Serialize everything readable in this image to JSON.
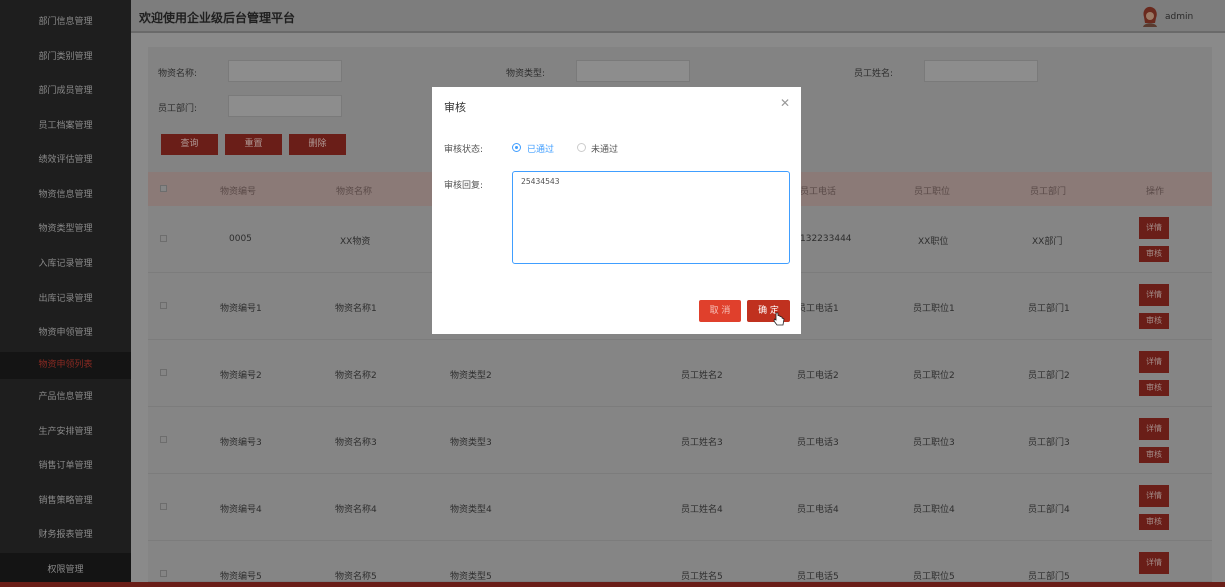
{
  "header": {
    "title": "欢迎使用企业级后台管理平台",
    "user": "admin",
    "avatar_icon": "user-avatar-icon"
  },
  "sidebar": {
    "items": [
      {
        "label": "部门信息管理"
      },
      {
        "label": "部门类别管理"
      },
      {
        "label": "部门成员管理"
      },
      {
        "label": "员工档案管理"
      },
      {
        "label": "绩效评估管理"
      },
      {
        "label": "物资信息管理"
      },
      {
        "label": "物资类型管理"
      },
      {
        "label": "入库记录管理"
      },
      {
        "label": "出库记录管理"
      },
      {
        "label": "物资申领管理"
      },
      {
        "label": "物资申领列表"
      },
      {
        "label": "产品信息管理"
      },
      {
        "label": "生产安排管理"
      },
      {
        "label": "销售订单管理"
      },
      {
        "label": "销售策略管理"
      },
      {
        "label": "财务报表管理"
      },
      {
        "label": "权限管理"
      }
    ]
  },
  "filters": {
    "material_name": {
      "label": "物资名称:",
      "value": ""
    },
    "material_type": {
      "label": "物资类型:",
      "value": ""
    },
    "employee_name": {
      "label": "员工姓名:",
      "value": ""
    },
    "employee_dept": {
      "label": "员工部门:",
      "value": ""
    },
    "query_label": "查询",
    "reset_label": "重置",
    "delete_label": "删除"
  },
  "table": {
    "columns": [
      "物资编号",
      "物资名称",
      "员工电话",
      "员工职位",
      "员工部门",
      "操作"
    ],
    "rows": [
      {
        "id": "0005",
        "name": "XX物资",
        "type": "",
        "emp": "",
        "phone": "132233444",
        "pos": "XX职位",
        "dept": "XX部门"
      },
      {
        "id": "物资编号1",
        "name": "物资名称1",
        "type": "",
        "emp": "",
        "phone": "员工电话1",
        "pos": "员工职位1",
        "dept": "员工部门1"
      },
      {
        "id": "物资编号2",
        "name": "物资名称2",
        "type": "物资类型2",
        "emp": "员工姓名2",
        "phone": "员工电话2",
        "pos": "员工职位2",
        "dept": "员工部门2"
      },
      {
        "id": "物资编号3",
        "name": "物资名称3",
        "type": "物资类型3",
        "emp": "员工姓名3",
        "phone": "员工电话3",
        "pos": "员工职位3",
        "dept": "员工部门3"
      },
      {
        "id": "物资编号4",
        "name": "物资名称4",
        "type": "物资类型4",
        "emp": "员工姓名4",
        "phone": "员工电话4",
        "pos": "员工职位4",
        "dept": "员工部门4"
      },
      {
        "id": "物资编号5",
        "name": "物资名称5",
        "type": "物资类型5",
        "emp": "员工姓名5",
        "phone": "员工电话5",
        "pos": "员工职位5",
        "dept": "员工部门5"
      }
    ],
    "detail_label": "详情",
    "review_label": "审核"
  },
  "modal": {
    "title": "审核",
    "close_icon": "close-icon",
    "status_label": "审核状态:",
    "status_options": [
      {
        "label": "已通过",
        "selected": true
      },
      {
        "label": "未通过",
        "selected": false
      }
    ],
    "reply_label": "审核回复:",
    "reply_value": "25434543",
    "cancel_label": "取 消",
    "confirm_label": "确 定"
  },
  "colors": {
    "accent": "#c0311f",
    "primary_blue": "#409eff",
    "sidebar_bg": "#1e1e1e"
  }
}
